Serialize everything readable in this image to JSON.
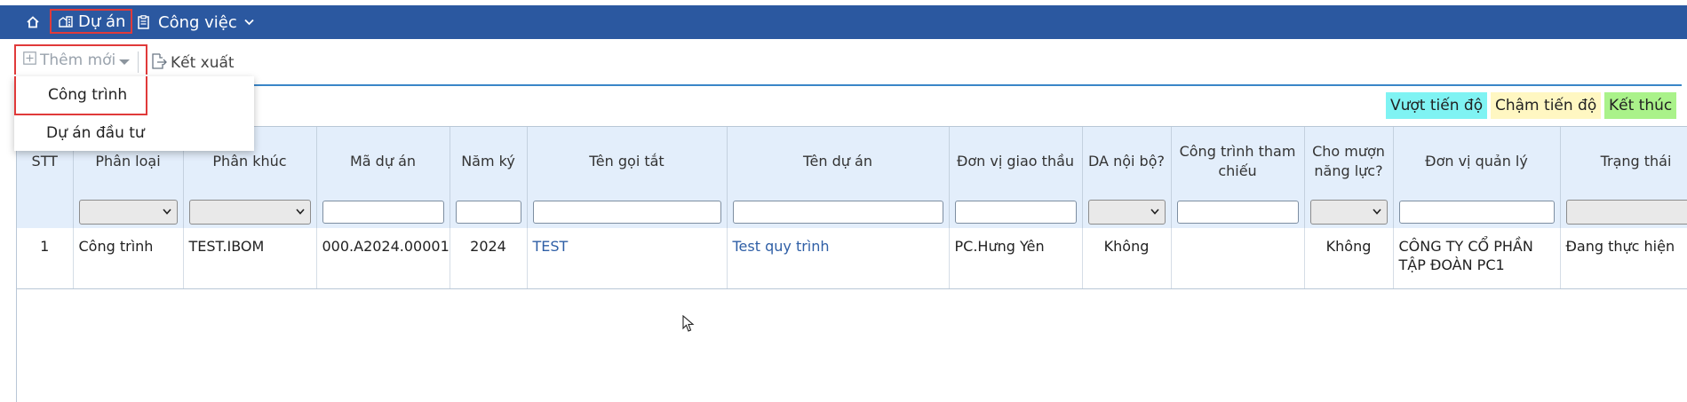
{
  "nav": {
    "home_icon": "home-icon",
    "du_an": "Dự án",
    "cong_viec": "Công việc"
  },
  "toolbar": {
    "add_label": "Thêm mới",
    "export_label": "Kết xuất"
  },
  "dropdown": {
    "items": [
      "Công trình",
      "Dự án đầu tư"
    ]
  },
  "legend": {
    "ahead": "Vượt tiến độ",
    "late": "Chậm tiến độ",
    "done": "Kết thúc",
    "ahead_color": "#7ff3f3",
    "late_color": "#fff7c2",
    "done_color": "#aaf28a"
  },
  "table": {
    "headers": [
      "STT",
      "Phân loại",
      "Phân khúc",
      "Mã dự án",
      "Năm ký",
      "Tên gọi tắt",
      "Tên dự án",
      "Đơn vị giao thầu",
      "DA nội bộ?",
      "Công trình tham chiếu",
      "Cho mượn năng lực?",
      "Đơn vị quản lý",
      "Trạng thái"
    ],
    "rows": [
      [
        "1",
        "Công trình",
        "TEST.IBOM",
        "000.A2024.00001",
        "2024",
        "TEST",
        "Test quy trình",
        "PC.Hưng Yên",
        "Không",
        "",
        "Không",
        "CÔNG TY CỔ PHẦN TẬP ĐOÀN PC1",
        "Đang thực hiện"
      ]
    ]
  },
  "colors": {
    "nav_bg": "#2b58a0",
    "header_bg": "#e3eefb",
    "link": "#2f5fa6",
    "highlight_border": "#e03a3a"
  }
}
